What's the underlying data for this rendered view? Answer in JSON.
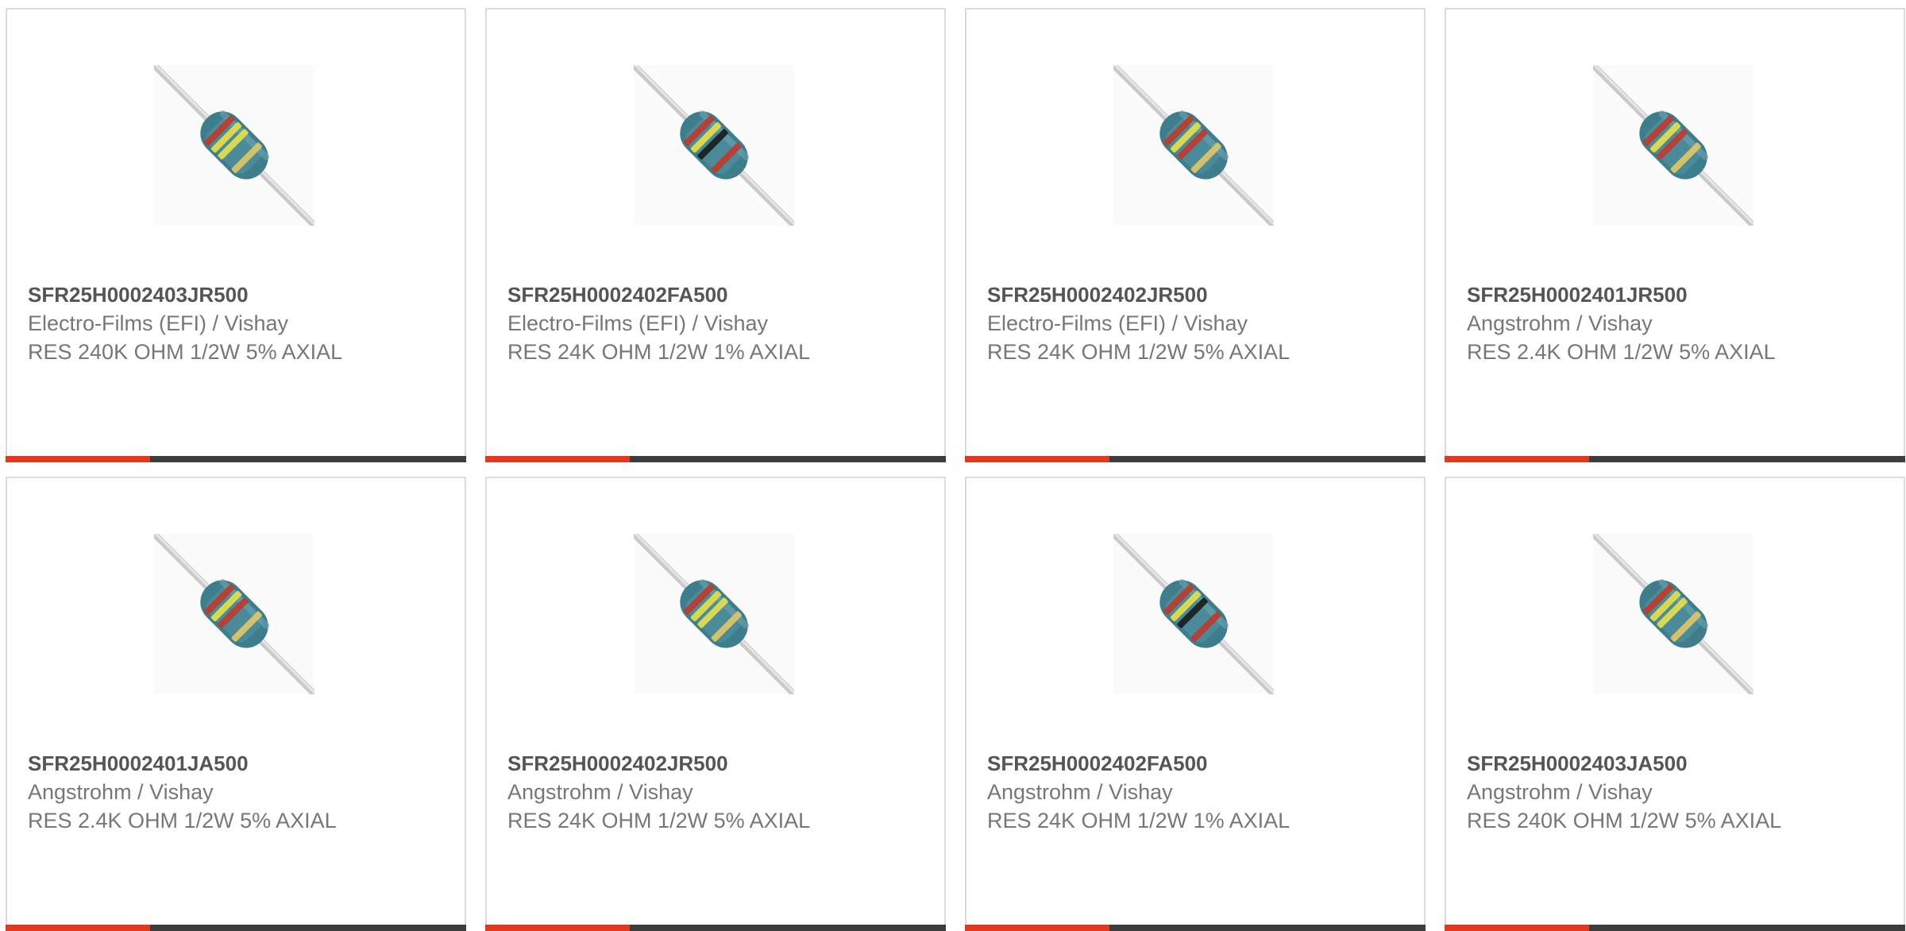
{
  "colors": {
    "accent": "#e3371e",
    "bar": "#3d3d3d",
    "border": "#dcdcdc",
    "body_band": "#3d7d8c"
  },
  "products": [
    {
      "part_number": "SFR25H0002403JR500",
      "manufacturer": "Electro-Films (EFI) / Vishay",
      "description": "RES 240K OHM 1/2W 5% AXIAL",
      "bands": [
        "#c0392b",
        "#e8e04a",
        "#e8e04a",
        "#e2c766"
      ]
    },
    {
      "part_number": "SFR25H0002402FA500",
      "manufacturer": "Electro-Films (EFI) / Vishay",
      "description": "RES 24K OHM 1/2W 1% AXIAL",
      "bands": [
        "#c0392b",
        "#e8e04a",
        "#1a1a1a",
        "#c0392b"
      ]
    },
    {
      "part_number": "SFR25H0002402JR500",
      "manufacturer": "Electro-Films (EFI) / Vishay",
      "description": "RES 24K OHM 1/2W 5% AXIAL",
      "bands": [
        "#c0392b",
        "#e8e04a",
        "#c0392b",
        "#e2c766"
      ]
    },
    {
      "part_number": "SFR25H0002401JR500",
      "manufacturer": "Angstrohm / Vishay",
      "description": "RES 2.4K OHM 1/2W 5% AXIAL",
      "bands": [
        "#c0392b",
        "#e8e04a",
        "#c0392b",
        "#e2c766"
      ]
    },
    {
      "part_number": "SFR25H0002401JA500",
      "manufacturer": "Angstrohm / Vishay",
      "description": "RES 2.4K OHM 1/2W 5% AXIAL",
      "bands": [
        "#c0392b",
        "#e8e04a",
        "#c0392b",
        "#e2c766"
      ]
    },
    {
      "part_number": "SFR25H0002402JR500",
      "manufacturer": "Angstrohm / Vishay",
      "description": "RES 24K OHM 1/2W 5% AXIAL",
      "bands": [
        "#c0392b",
        "#e8e04a",
        "#e8e04a",
        "#e2c766"
      ]
    },
    {
      "part_number": "SFR25H0002402FA500",
      "manufacturer": "Angstrohm / Vishay",
      "description": "RES 24K OHM 1/2W 1% AXIAL",
      "bands": [
        "#c0392b",
        "#e8e04a",
        "#1a1a1a",
        "#c0392b"
      ]
    },
    {
      "part_number": "SFR25H0002403JA500",
      "manufacturer": "Angstrohm / Vishay",
      "description": "RES 240K OHM 1/2W 5% AXIAL",
      "bands": [
        "#c0392b",
        "#e8e04a",
        "#e8e04a",
        "#e2c766"
      ]
    }
  ]
}
